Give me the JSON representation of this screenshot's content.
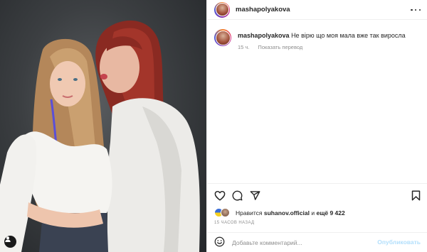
{
  "post": {
    "username": "mashapolyakova",
    "caption": {
      "author": "mashapolyakova",
      "text": "Не вірю що моя мала вже так виросла"
    },
    "caption_age": "15 ч.",
    "translate_label": "Показать перевод",
    "likes": {
      "prefix": "Нравится",
      "liked_by": "suhanov.official",
      "connector": "и",
      "others": "ещё 9 422"
    },
    "timestamp": "15 ЧАСОВ НАЗАД",
    "comment_placeholder": "Добавьте комментарий...",
    "publish_label": "Опубликовать"
  },
  "icons": {
    "more": "more-horizontal-icon",
    "like": "heart-icon",
    "comment": "comment-bubble-icon",
    "share": "paper-plane-icon",
    "save": "bookmark-icon",
    "emoji": "emoji-smile-icon",
    "user_tag": "user-tag-icon"
  },
  "colors": {
    "text": "#262626",
    "secondary": "#8e8e8e",
    "divider": "#efefef",
    "publish_disabled": "#b2dffc"
  }
}
